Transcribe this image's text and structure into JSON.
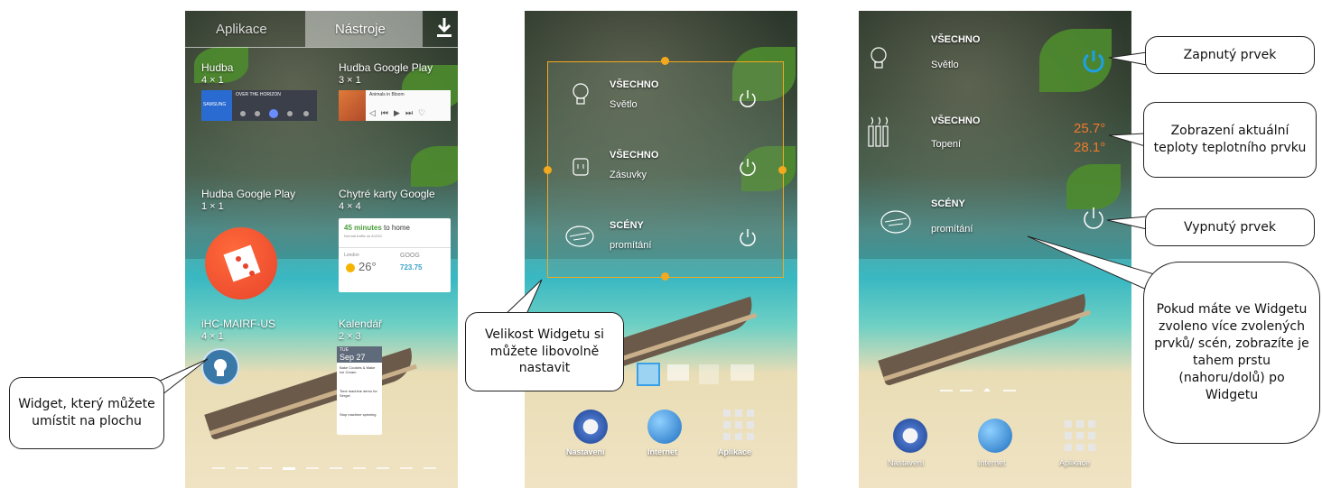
{
  "phone1": {
    "tabs": [
      "Aplikace",
      "Nástroje"
    ],
    "widgets": [
      {
        "title": "Hudba",
        "size": "4 × 1"
      },
      {
        "title": "Hudba Google Play",
        "size": "3 × 1"
      },
      {
        "title": "Hudba Google Play",
        "size": "1 × 1"
      },
      {
        "title": "Chytré karty Google",
        "size": "4 × 4"
      },
      {
        "title": "iHC-MAIRF-US",
        "size": "4 × 1"
      },
      {
        "title": "Kalendář",
        "size": "2 × 3"
      }
    ],
    "music": {
      "song": "OVER THE HORIZON",
      "brand": "SAMSUNG"
    },
    "gplay": {
      "song": "Animals in Bloom"
    },
    "gnow": {
      "commute": "45 minutes",
      "commute_rest": " to home",
      "sub": "Normal traffic on A1234",
      "city": "London",
      "temp": "26°",
      "stock": "GOOG",
      "stock_value": "723.75"
    },
    "calendar": {
      "day": "TUE",
      "date": "Sep 27",
      "events": [
        "Bake Cookies & Make Ice Cream",
        "Time machine demo for Sergei",
        "Stop machine spinning"
      ]
    }
  },
  "phone2": {
    "rows": [
      {
        "head": "VŠECHNO",
        "sub": "Světlo"
      },
      {
        "head": "VŠECHNO",
        "sub": "Zásuvky"
      },
      {
        "head": "SCÉNY",
        "sub": "promítání"
      }
    ],
    "dock": [
      "Nastavení",
      "Internet",
      "Aplikace"
    ]
  },
  "phone3": {
    "rows": [
      {
        "head": "VŠECHNO",
        "sub": "Světlo"
      },
      {
        "head": "VŠECHNO",
        "sub": "Topení"
      },
      {
        "head": "SCÉNY",
        "sub": "promítání"
      }
    ],
    "temp1": "25.7°",
    "temp2": "28.1°",
    "dock": [
      "Nastavení",
      "Internet",
      "Aplikace"
    ]
  },
  "callouts": {
    "widget_place": "Widget, který můžete umístit na plochu",
    "widget_size": "Velikost Widgetu si můžete libovolně nastavit",
    "on": "Zapnutý prvek",
    "temp": "Zobrazení aktuální teploty teplotního prvku",
    "off": "Vypnutý prvek",
    "swipe": "Pokud máte ve Widgetu zvoleno více zvolených prvků/ scén, zobrazíte je tahem prstu (nahoru/dolů) po Widgetu"
  },
  "colors": {
    "accent_orange": "#f4a81d",
    "power_on": "#1ea0e6",
    "temp": "#f07a2a"
  }
}
